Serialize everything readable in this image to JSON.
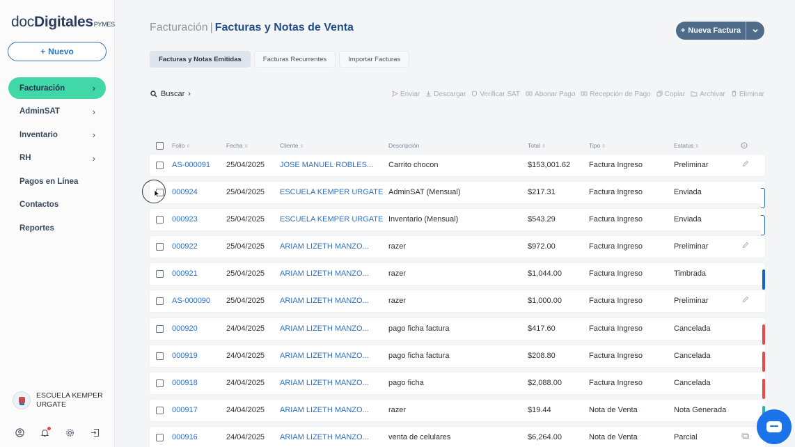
{
  "sidebar": {
    "logo_light": "doc",
    "logo_bold": "Digitales",
    "logo_suffix": "PYMES",
    "new_button": "Nuevo",
    "nav": [
      {
        "label": "Facturación",
        "has_chevron": true,
        "active": true
      },
      {
        "label": "AdminSAT",
        "has_chevron": true
      },
      {
        "label": "Inventario",
        "has_chevron": true
      },
      {
        "label": "RH",
        "has_chevron": true
      },
      {
        "label": "Pagos en Línea"
      },
      {
        "label": "Contactos"
      },
      {
        "label": "Reportes"
      }
    ],
    "org_name": "ESCUELA KEMPER URGATE",
    "bottom_icons": [
      "user-icon",
      "bell-icon",
      "settings-icon",
      "logout-icon"
    ]
  },
  "header": {
    "crumb": "Facturación",
    "separator": "|",
    "title": "Facturas y Notas de Venta",
    "new_invoice": "Nueva Factura"
  },
  "tabs": [
    {
      "label": "Facturas y Notas Emitidas",
      "active": true
    },
    {
      "label": "Facturas Recurrentes"
    },
    {
      "label": "Importar Facturas"
    }
  ],
  "toolbar": {
    "search": "Buscar",
    "actions": [
      "Enviar",
      "Descargar",
      "Verificar SAT",
      "Abonar Pago",
      "Recepción de Pago",
      "Copiar",
      "Archivar",
      "Eliminar"
    ]
  },
  "table": {
    "headers": {
      "folio": "Folio",
      "fecha": "Fecha",
      "cliente": "Cliente",
      "descripcion": "Descripción",
      "total": "Total",
      "tipo": "Tipo",
      "estatus": "Estatus"
    },
    "rows": [
      {
        "folio": "AS-000091",
        "fecha": "25/04/2025",
        "cliente": "JOSE MANUEL ROBLES...",
        "descripcion": "Carrito chocon",
        "total": "$153,001.62",
        "tipo": "Factura Ingreso",
        "estatus": "Preliminar"
      },
      {
        "folio": "000924",
        "fecha": "25/04/2025",
        "cliente": "ESCUELA KEMPER URGATE",
        "descripcion": "AdminSAT (Mensual)",
        "total": "$217.31",
        "tipo": "Factura Ingreso",
        "estatus": "Enviada"
      },
      {
        "folio": "000923",
        "fecha": "25/04/2025",
        "cliente": "ESCUELA KEMPER URGATE",
        "descripcion": "Inventario (Mensual)",
        "total": "$543.29",
        "tipo": "Factura Ingreso",
        "estatus": "Enviada"
      },
      {
        "folio": "000922",
        "fecha": "25/04/2025",
        "cliente": "ARIAM LIZETH MANZO...",
        "descripcion": "razer",
        "total": "$972.00",
        "tipo": "Factura Ingreso",
        "estatus": "Preliminar"
      },
      {
        "folio": "000921",
        "fecha": "25/04/2025",
        "cliente": "ARIAM LIZETH MANZO...",
        "descripcion": "razer",
        "total": "$1,044.00",
        "tipo": "Factura Ingreso",
        "estatus": "Timbrada"
      },
      {
        "folio": "AS-000090",
        "fecha": "25/04/2025",
        "cliente": "ARIAM LIZETH MANZO...",
        "descripcion": "razer",
        "total": "$1,000.00",
        "tipo": "Factura Ingreso",
        "estatus": "Preliminar"
      },
      {
        "folio": "000920",
        "fecha": "24/04/2025",
        "cliente": "ARIAM LIZETH MANZO...",
        "descripcion": "pago ficha factura",
        "total": "$417.60",
        "tipo": "Factura Ingreso",
        "estatus": "Cancelada"
      },
      {
        "folio": "000919",
        "fecha": "24/04/2025",
        "cliente": "ARIAM LIZETH MANZO...",
        "descripcion": "pago ficha factura",
        "total": "$208.80",
        "tipo": "Factura Ingreso",
        "estatus": "Cancelada"
      },
      {
        "folio": "000918",
        "fecha": "24/04/2025",
        "cliente": "ARIAM LIZETH MANZO...",
        "descripcion": "pago ficha",
        "total": "$2,088.00",
        "tipo": "Factura Ingreso",
        "estatus": "Cancelada"
      },
      {
        "folio": "000917",
        "fecha": "24/04/2025",
        "cliente": "ARIAM LIZETH MANZO...",
        "descripcion": "razer",
        "total": "$19.44",
        "tipo": "Nota de Venta",
        "estatus": "Nota Generada"
      },
      {
        "folio": "000916",
        "fecha": "24/04/2025",
        "cliente": "ARIAM LIZETH MANZO...",
        "descripcion": "venta de celulares",
        "total": "$6,264.00",
        "tipo": "Nota de Venta",
        "estatus": "Parcial"
      }
    ]
  },
  "status_colors": {
    "Preliminar": "none",
    "Enviada": "#2e6fbf",
    "Timbrada": "#1565c0",
    "Cancelada": "#e54b4b",
    "Nota Generada": "#26b5b5",
    "Parcial": "none"
  },
  "colors": {
    "accent": "#41d7a7",
    "link": "#2e6fbf",
    "title": "#1f4f8b",
    "chat": "#1a73e8"
  }
}
